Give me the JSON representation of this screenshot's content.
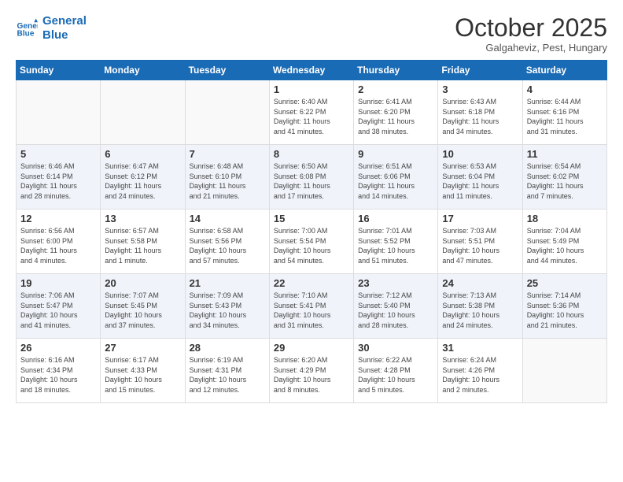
{
  "logo": {
    "line1": "General",
    "line2": "Blue"
  },
  "title": "October 2025",
  "location": "Galgaheviz, Pest, Hungary",
  "weekdays": [
    "Sunday",
    "Monday",
    "Tuesday",
    "Wednesday",
    "Thursday",
    "Friday",
    "Saturday"
  ],
  "weeks": [
    [
      {
        "day": "",
        "info": ""
      },
      {
        "day": "",
        "info": ""
      },
      {
        "day": "",
        "info": ""
      },
      {
        "day": "1",
        "info": "Sunrise: 6:40 AM\nSunset: 6:22 PM\nDaylight: 11 hours\nand 41 minutes."
      },
      {
        "day": "2",
        "info": "Sunrise: 6:41 AM\nSunset: 6:20 PM\nDaylight: 11 hours\nand 38 minutes."
      },
      {
        "day": "3",
        "info": "Sunrise: 6:43 AM\nSunset: 6:18 PM\nDaylight: 11 hours\nand 34 minutes."
      },
      {
        "day": "4",
        "info": "Sunrise: 6:44 AM\nSunset: 6:16 PM\nDaylight: 11 hours\nand 31 minutes."
      }
    ],
    [
      {
        "day": "5",
        "info": "Sunrise: 6:46 AM\nSunset: 6:14 PM\nDaylight: 11 hours\nand 28 minutes."
      },
      {
        "day": "6",
        "info": "Sunrise: 6:47 AM\nSunset: 6:12 PM\nDaylight: 11 hours\nand 24 minutes."
      },
      {
        "day": "7",
        "info": "Sunrise: 6:48 AM\nSunset: 6:10 PM\nDaylight: 11 hours\nand 21 minutes."
      },
      {
        "day": "8",
        "info": "Sunrise: 6:50 AM\nSunset: 6:08 PM\nDaylight: 11 hours\nand 17 minutes."
      },
      {
        "day": "9",
        "info": "Sunrise: 6:51 AM\nSunset: 6:06 PM\nDaylight: 11 hours\nand 14 minutes."
      },
      {
        "day": "10",
        "info": "Sunrise: 6:53 AM\nSunset: 6:04 PM\nDaylight: 11 hours\nand 11 minutes."
      },
      {
        "day": "11",
        "info": "Sunrise: 6:54 AM\nSunset: 6:02 PM\nDaylight: 11 hours\nand 7 minutes."
      }
    ],
    [
      {
        "day": "12",
        "info": "Sunrise: 6:56 AM\nSunset: 6:00 PM\nDaylight: 11 hours\nand 4 minutes."
      },
      {
        "day": "13",
        "info": "Sunrise: 6:57 AM\nSunset: 5:58 PM\nDaylight: 11 hours\nand 1 minute."
      },
      {
        "day": "14",
        "info": "Sunrise: 6:58 AM\nSunset: 5:56 PM\nDaylight: 10 hours\nand 57 minutes."
      },
      {
        "day": "15",
        "info": "Sunrise: 7:00 AM\nSunset: 5:54 PM\nDaylight: 10 hours\nand 54 minutes."
      },
      {
        "day": "16",
        "info": "Sunrise: 7:01 AM\nSunset: 5:52 PM\nDaylight: 10 hours\nand 51 minutes."
      },
      {
        "day": "17",
        "info": "Sunrise: 7:03 AM\nSunset: 5:51 PM\nDaylight: 10 hours\nand 47 minutes."
      },
      {
        "day": "18",
        "info": "Sunrise: 7:04 AM\nSunset: 5:49 PM\nDaylight: 10 hours\nand 44 minutes."
      }
    ],
    [
      {
        "day": "19",
        "info": "Sunrise: 7:06 AM\nSunset: 5:47 PM\nDaylight: 10 hours\nand 41 minutes."
      },
      {
        "day": "20",
        "info": "Sunrise: 7:07 AM\nSunset: 5:45 PM\nDaylight: 10 hours\nand 37 minutes."
      },
      {
        "day": "21",
        "info": "Sunrise: 7:09 AM\nSunset: 5:43 PM\nDaylight: 10 hours\nand 34 minutes."
      },
      {
        "day": "22",
        "info": "Sunrise: 7:10 AM\nSunset: 5:41 PM\nDaylight: 10 hours\nand 31 minutes."
      },
      {
        "day": "23",
        "info": "Sunrise: 7:12 AM\nSunset: 5:40 PM\nDaylight: 10 hours\nand 28 minutes."
      },
      {
        "day": "24",
        "info": "Sunrise: 7:13 AM\nSunset: 5:38 PM\nDaylight: 10 hours\nand 24 minutes."
      },
      {
        "day": "25",
        "info": "Sunrise: 7:14 AM\nSunset: 5:36 PM\nDaylight: 10 hours\nand 21 minutes."
      }
    ],
    [
      {
        "day": "26",
        "info": "Sunrise: 6:16 AM\nSunset: 4:34 PM\nDaylight: 10 hours\nand 18 minutes."
      },
      {
        "day": "27",
        "info": "Sunrise: 6:17 AM\nSunset: 4:33 PM\nDaylight: 10 hours\nand 15 minutes."
      },
      {
        "day": "28",
        "info": "Sunrise: 6:19 AM\nSunset: 4:31 PM\nDaylight: 10 hours\nand 12 minutes."
      },
      {
        "day": "29",
        "info": "Sunrise: 6:20 AM\nSunset: 4:29 PM\nDaylight: 10 hours\nand 8 minutes."
      },
      {
        "day": "30",
        "info": "Sunrise: 6:22 AM\nSunset: 4:28 PM\nDaylight: 10 hours\nand 5 minutes."
      },
      {
        "day": "31",
        "info": "Sunrise: 6:24 AM\nSunset: 4:26 PM\nDaylight: 10 hours\nand 2 minutes."
      },
      {
        "day": "",
        "info": ""
      }
    ]
  ]
}
